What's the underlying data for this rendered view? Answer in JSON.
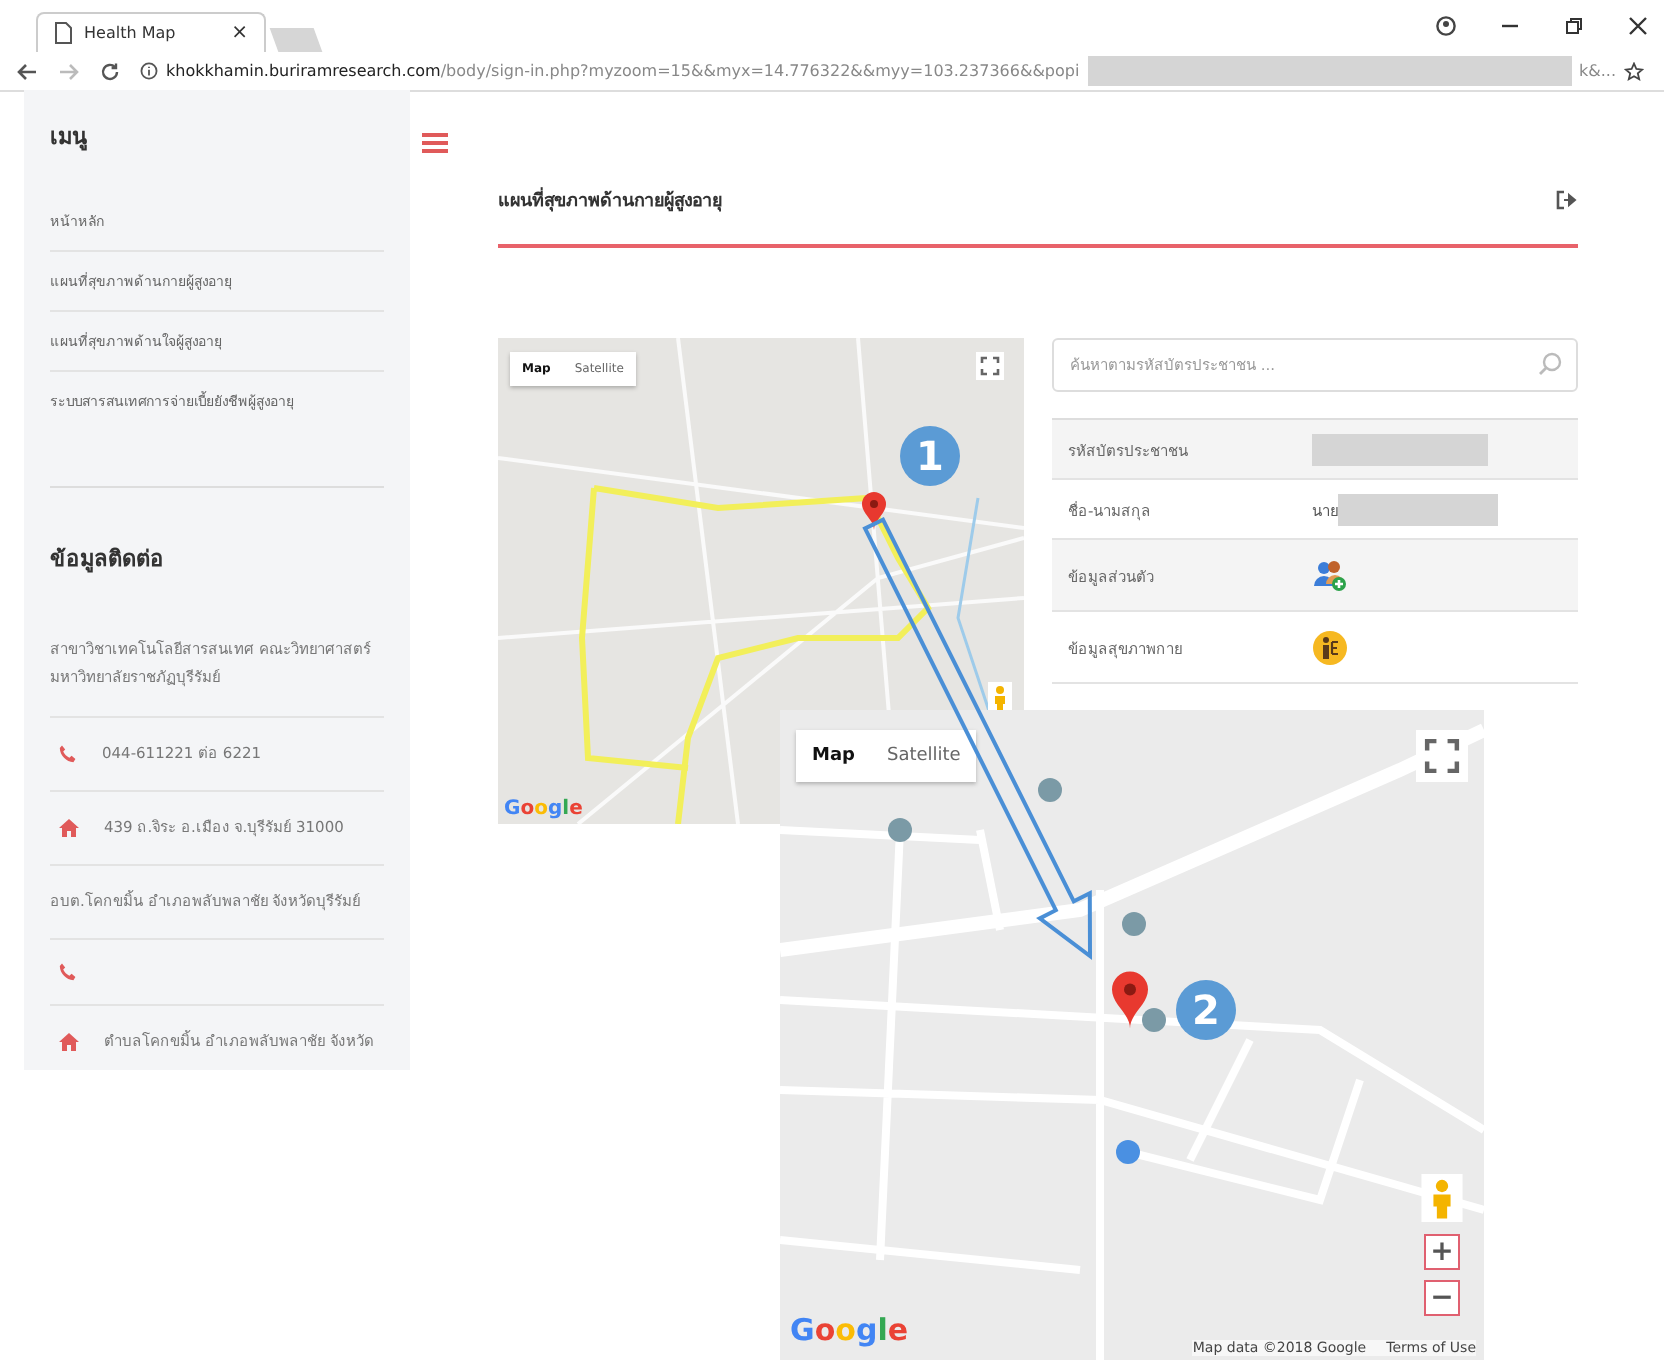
{
  "browser": {
    "tab_title": "Health Map",
    "tab_close": "×",
    "url_host": "khokkhamin.buriramresearch.com",
    "url_path": "/body/sign-in.php?myzoom=15&&myx=14.776322&&myy=103.237366&&popi",
    "url_tail": "k&..."
  },
  "sidebar": {
    "menu_title": "เมนู",
    "menu_items": [
      "หน้าหลัก",
      "แผนที่สุขภาพด้านกายผู้สูงอายุ",
      "แผนที่สุขภาพด้านใจผู้สูงอายุ",
      "ระบบสารสนเทศการจ่ายเบี้ยยังชีพผู้สูงอายุ"
    ],
    "contact_title": "ข้อมูลติดต่อ",
    "contact_items": [
      {
        "kind": "text",
        "text": "สาขาวิชาเทคโนโลยีสารสนเทศ คณะวิทยาศาสตร์ มหาวิทยาลัยราชภัฏบุรีรัมย์"
      },
      {
        "kind": "phone",
        "text": "044-611221 ต่อ 6221"
      },
      {
        "kind": "home",
        "text": "439 ถ.จิระ อ.เมือง จ.บุรีรัมย์ 31000"
      },
      {
        "kind": "text",
        "text": "อบต.โคกขมิ้น อำเภอพลับพลาชัย จังหวัดบุรีรัมย์"
      },
      {
        "kind": "phone"
      },
      {
        "kind": "home",
        "text": "ตำบลโคกขมิ้น อำเภอพลับพลาชัย จังหวัด"
      }
    ]
  },
  "main": {
    "title": "แผนที่สุขภาพด้านกายผู้สูงอายุ",
    "map": {
      "map_types": [
        {
          "label": "Map",
          "selected": true
        },
        {
          "label": "Satellite",
          "selected": false
        }
      ],
      "logo": "Google"
    },
    "search": {
      "placeholder": "ค้นหาตามรหัสบัตรประชาชน ..."
    },
    "rows": [
      {
        "label": "รหัสบัตรประชาชน",
        "kind": "redacted"
      },
      {
        "label": "ชื่อ-นามสกุล",
        "kind": "redacted",
        "prefix": "นาย"
      },
      {
        "label": "ข้อมูลส่วนตัว",
        "kind": "person-icon"
      },
      {
        "label": "ข้อมูลสุขภาพกาย",
        "kind": "body-icon"
      }
    ]
  },
  "inset": {
    "map_types": [
      {
        "label": "Map",
        "selected": true
      },
      {
        "label": "Satellite",
        "selected": false
      }
    ],
    "logo": "Google",
    "zoom_in": "+",
    "zoom_out": "−",
    "attribution": "Map data ©2018 Google",
    "terms": "Terms of Use"
  },
  "annotations": [
    {
      "text": "1"
    },
    {
      "text": "2"
    }
  ]
}
